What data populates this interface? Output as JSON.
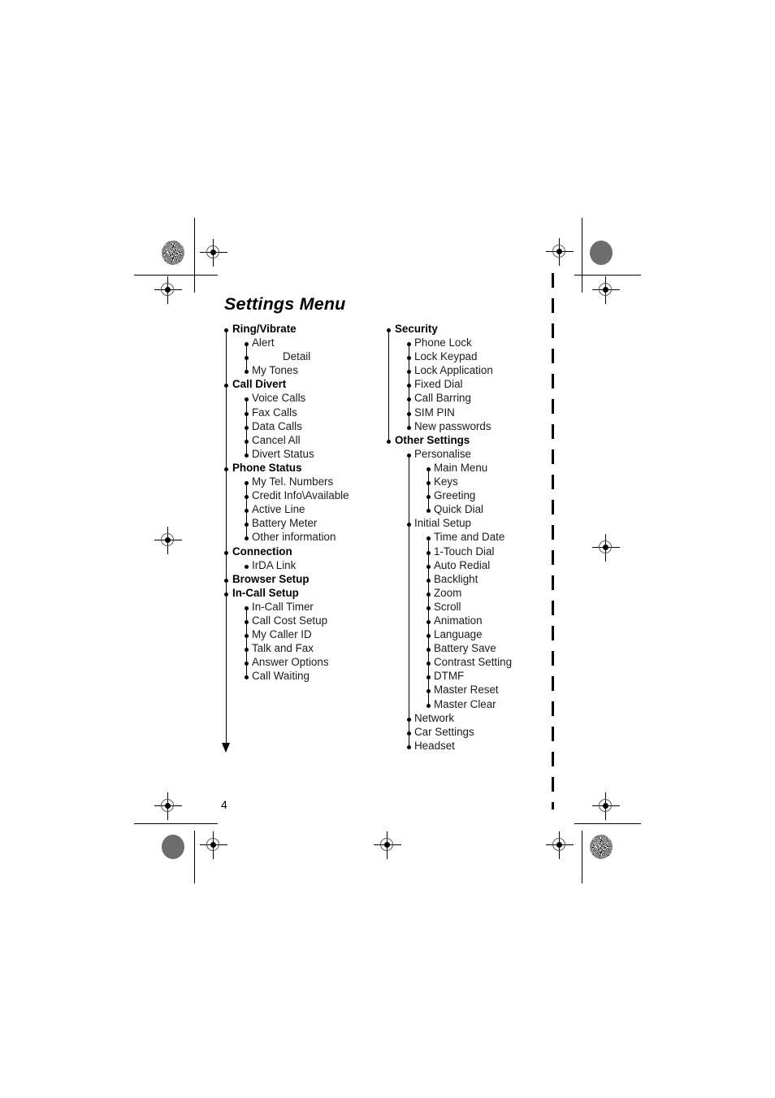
{
  "document": {
    "title": "Settings Menu",
    "page_number": "4"
  },
  "menu": {
    "left_column": [
      {
        "level": 1,
        "label": "Ring/Vibrate"
      },
      {
        "level": 2,
        "label": "Alert"
      },
      {
        "level": 2,
        "label": "Detail",
        "deep_text": true
      },
      {
        "level": 2,
        "label": "My Tones"
      },
      {
        "level": 1,
        "label": "Call Divert"
      },
      {
        "level": 2,
        "label": "Voice Calls"
      },
      {
        "level": 2,
        "label": "Fax Calls"
      },
      {
        "level": 2,
        "label": "Data Calls"
      },
      {
        "level": 2,
        "label": "Cancel All"
      },
      {
        "level": 2,
        "label": "Divert Status"
      },
      {
        "level": 1,
        "label": "Phone Status"
      },
      {
        "level": 2,
        "label": "My Tel. Numbers"
      },
      {
        "level": 2,
        "label": "Credit Info\\Available"
      },
      {
        "level": 2,
        "label": "Active Line"
      },
      {
        "level": 2,
        "label": "Battery Meter"
      },
      {
        "level": 2,
        "label": "Other information"
      },
      {
        "level": 1,
        "label": "Connection"
      },
      {
        "level": 2,
        "label": "IrDA Link"
      },
      {
        "level": 1,
        "label": "Browser Setup"
      },
      {
        "level": 1,
        "label": "In-Call Setup"
      },
      {
        "level": 2,
        "label": "In-Call Timer"
      },
      {
        "level": 2,
        "label": "Call Cost Setup"
      },
      {
        "level": 2,
        "label": "My Caller ID"
      },
      {
        "level": 2,
        "label": "Talk and Fax"
      },
      {
        "level": 2,
        "label": "Answer Options"
      },
      {
        "level": 2,
        "label": "Call Waiting"
      }
    ],
    "right_column": [
      {
        "level": 1,
        "label": "Security"
      },
      {
        "level": 2,
        "label": "Phone Lock"
      },
      {
        "level": 2,
        "label": "Lock Keypad"
      },
      {
        "level": 2,
        "label": "Lock Application"
      },
      {
        "level": 2,
        "label": "Fixed Dial"
      },
      {
        "level": 2,
        "label": "Call Barring"
      },
      {
        "level": 2,
        "label": "SIM PIN"
      },
      {
        "level": 2,
        "label": "New passwords"
      },
      {
        "level": 1,
        "label": "Other Settings"
      },
      {
        "level": 2,
        "label": "Personalise"
      },
      {
        "level": 3,
        "label": "Main Menu"
      },
      {
        "level": 3,
        "label": "Keys"
      },
      {
        "level": 3,
        "label": "Greeting"
      },
      {
        "level": 3,
        "label": "Quick Dial"
      },
      {
        "level": 2,
        "label": "Initial Setup"
      },
      {
        "level": 3,
        "label": "Time and Date"
      },
      {
        "level": 3,
        "label": "1-Touch Dial"
      },
      {
        "level": 3,
        "label": "Auto Redial"
      },
      {
        "level": 3,
        "label": "Backlight"
      },
      {
        "level": 3,
        "label": "Zoom"
      },
      {
        "level": 3,
        "label": "Scroll"
      },
      {
        "level": 3,
        "label": "Animation"
      },
      {
        "level": 3,
        "label": "Language"
      },
      {
        "level": 3,
        "label": "Battery Save"
      },
      {
        "level": 3,
        "label": "Contrast Setting"
      },
      {
        "level": 3,
        "label": "DTMF"
      },
      {
        "level": 3,
        "label": "Master Reset"
      },
      {
        "level": 3,
        "label": "Master Clear"
      },
      {
        "level": 2,
        "label": "Network"
      },
      {
        "level": 2,
        "label": "Car Settings"
      },
      {
        "level": 2,
        "label": "Headset"
      }
    ]
  },
  "prepress": {
    "registration_mark_name": "registration-target-icon",
    "density_patch_name": "density-patch",
    "fold_line_name": "dashed-fold-line",
    "ink": "#000000"
  }
}
